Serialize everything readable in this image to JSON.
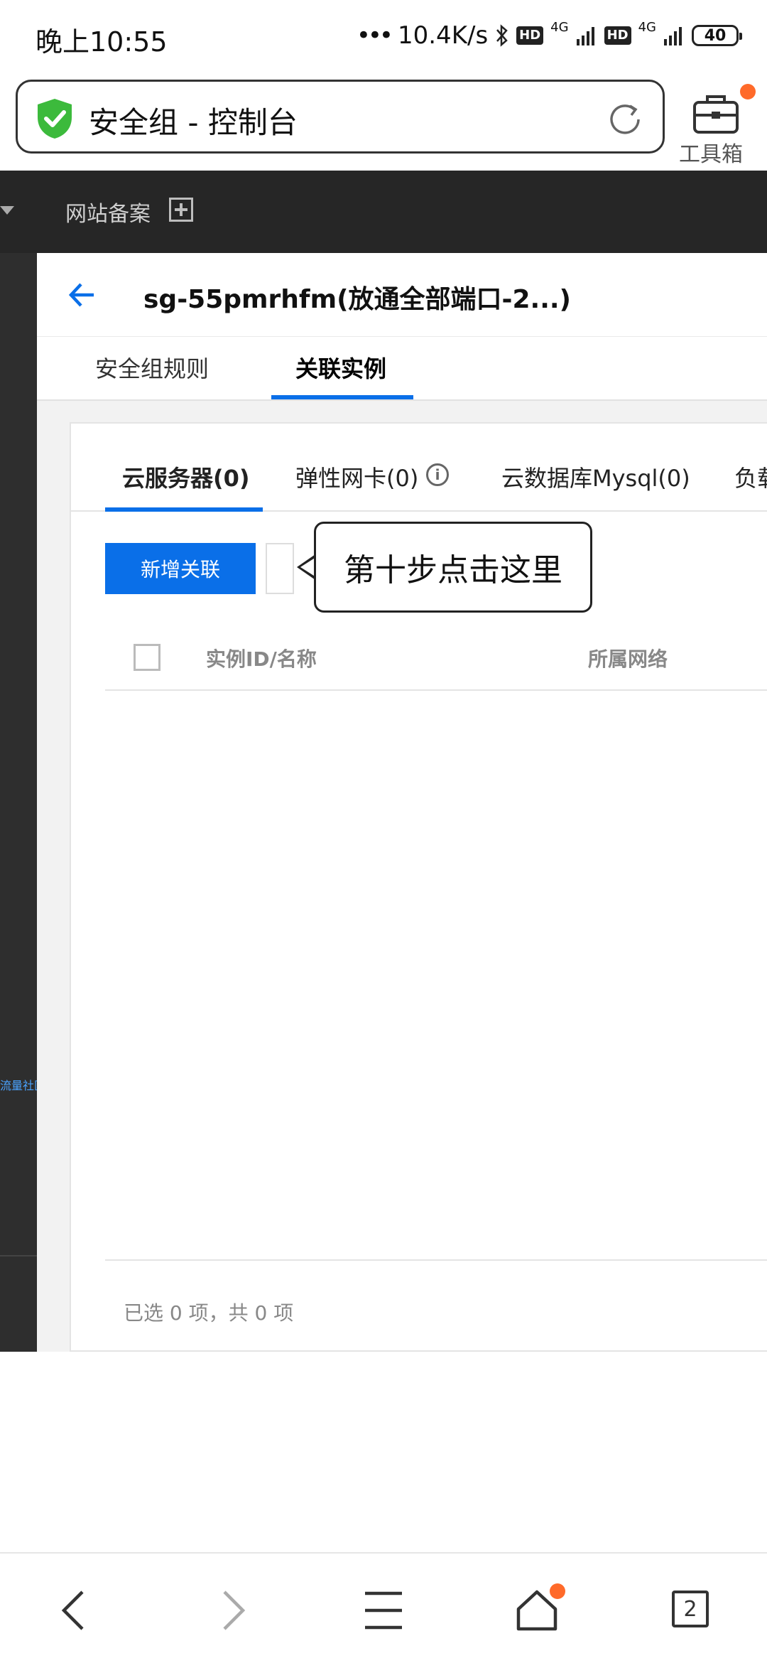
{
  "status_bar": {
    "time": "晚上10:55",
    "dots": "•••",
    "speed": "10.4K/s",
    "hd1": "HD",
    "net1": "4G",
    "hd2": "HD",
    "net2": "4G",
    "battery": "40"
  },
  "browser": {
    "page_title": "安全组 - 控制台",
    "toolbox_label": "工具箱"
  },
  "top_nav": {
    "item_label": "网站备案"
  },
  "sidebar": {
    "link_text": "流量社区"
  },
  "detail": {
    "title": "sg-55pmrhfm(放通全部端口-2...)",
    "tabs": [
      {
        "label": "安全组规则"
      },
      {
        "label": "关联实例"
      }
    ]
  },
  "instances": {
    "subtabs": [
      {
        "label": "云服务器(0)"
      },
      {
        "label": "弹性网卡(0)"
      },
      {
        "label": "云数据库Mysql(0)"
      },
      {
        "label": "负载"
      }
    ],
    "info_icon_glyph": "i",
    "add_button_label": "新增关联",
    "callout_text": "第十步点击这里",
    "columns": [
      {
        "label": "实例ID/名称"
      },
      {
        "label": "所属网络"
      }
    ],
    "summary": "已选 0 项，共 0 项"
  },
  "bottom_nav": {
    "tab_count": "2"
  },
  "colors": {
    "accent": "#0a6fe8",
    "notification_dot": "#ff6a2a",
    "shield_green": "#3cba3c",
    "dark_nav": "#262626"
  }
}
